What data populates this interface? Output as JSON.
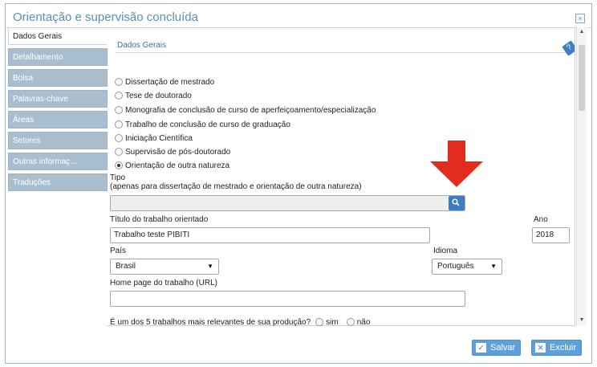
{
  "dialog": {
    "title": "Orientação e supervisão concluída",
    "close_symbol": "×"
  },
  "sidebar": {
    "items": [
      {
        "label": "Dados Gerais",
        "active": true
      },
      {
        "label": "Detalhamento",
        "active": false
      },
      {
        "label": "Bolsa",
        "active": false
      },
      {
        "label": "Palavras-chave",
        "active": false
      },
      {
        "label": "Áreas",
        "active": false
      },
      {
        "label": "Setores",
        "active": false
      },
      {
        "label": "Outras informaç...",
        "active": false
      },
      {
        "label": "Traduções",
        "active": false
      }
    ]
  },
  "panel": {
    "title": "Dados Gerais",
    "help_icon": "?",
    "radio_options": [
      {
        "label": "Dissertação de mestrado",
        "checked": false
      },
      {
        "label": "Tese de doutorado",
        "checked": false
      },
      {
        "label": "Monografia de conclusão de curso de aperfeiçoamento/especialização",
        "checked": false
      },
      {
        "label": "Trabalho de conclusão de curso de graduação",
        "checked": false
      },
      {
        "label": "Iniciação Científica",
        "checked": false
      },
      {
        "label": "Supervisão de pós-doutorado",
        "checked": false
      },
      {
        "label": "Orientação de outra natureza",
        "checked": true
      }
    ],
    "tipo_label": "Tipo",
    "tipo_note": "(apenas para dissertação de mestrado e orientação de outra natureza)",
    "tipo_value": "",
    "titulo_label": "Título do trabalho orientado",
    "titulo_value": "Trabalho teste PIBITI",
    "ano_label": "Ano",
    "ano_value": "2018",
    "pais_label": "País",
    "pais_value": "Brasil",
    "idioma_label": "Idioma",
    "idioma_value": "Português",
    "homepage_label": "Home page do trabalho (URL)",
    "homepage_value": "",
    "relevance_question": "É um dos 5 trabalhos mais relevantes de sua produção?",
    "relevance_sim": "sim",
    "relevance_nao": "não",
    "select_arrow": "▼"
  },
  "footer": {
    "save_label": "Salvar",
    "delete_label": "Excluir"
  },
  "colors": {
    "annotation_arrow": "#e32b1e",
    "title_text": "#5a8fb3",
    "button_blue": "#5fa0d8"
  },
  "icons": {
    "search": "search-icon",
    "help": "help-icon",
    "save": "check-icon",
    "delete": "x-icon",
    "annotation": "red-down-arrow"
  }
}
